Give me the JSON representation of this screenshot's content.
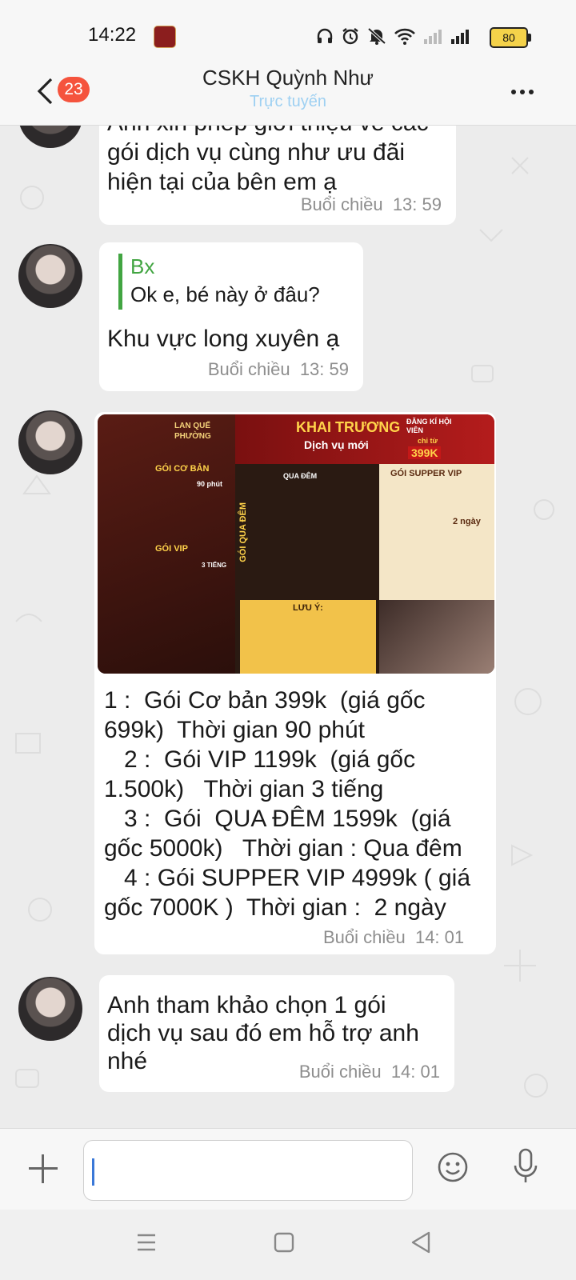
{
  "status_bar": {
    "time": "14:22",
    "battery": "80"
  },
  "header": {
    "title": "CSKH  Quỳnh Như",
    "presence": "Trực tuyến",
    "unread_badge": "23"
  },
  "messages": [
    {
      "lines": [
        "Anh xin phép giới thiệu vê các",
        "gói dịch vụ cùng như ưu đãi",
        "hiện tại của bên em ạ"
      ],
      "time": "Buổi chiều  13: 59"
    },
    {
      "quote": {
        "author": "Bx",
        "text": "Ok e, bé này ở đâu?"
      },
      "lines": [
        "Khu vực long xuyên ạ"
      ],
      "time": "Buổi chiều  13: 59"
    },
    {
      "lines": [
        "1 :  Gói Cơ bản 399k  (giá gốc",
        "699k)  Thời gian 90 phút",
        "   2 :  Gói VIP 1199k  (giá gốc",
        "1.500k)   Thời gian 3 tiếng",
        "   3 :  Gói  QUA ĐÊM 1599k  (giá",
        "gốc 5000k)   Thời gian : Qua đêm",
        "   4 : Gói SUPPER VIP 4999k ( giá",
        "gốc 7000K )  Thời gian :  2 ngày"
      ],
      "time": "Buổi chiều  14: 01"
    },
    {
      "lines": [
        "Anh tham khảo chọn 1 gói",
        "dịch vụ sau đó em hỗ trợ anh",
        "nhé"
      ],
      "time": "Buổi chiều  14: 01"
    }
  ],
  "promo_image": {
    "brand": "LAN QUẾ PHƯỜNG",
    "headline": "KHAI TRƯƠNG",
    "subheadline": "Dịch vụ mới",
    "member_label": "ĐĂNG KÍ HỘI VIÊN",
    "member_price_prefix": "chỉ từ",
    "member_price": "399K",
    "basic_title": "GÓI CƠ BẢN",
    "basic_duration": "90 phút",
    "vip_title": "GÓI VIP",
    "vip_duration": "3 TIẾNG",
    "overnight_title": "GÓI QUA ĐÊM",
    "overnight_tag": "QUA ĐÊM",
    "supper_title": "GÓI SUPPER VIP",
    "supper_duration": "2 ngày",
    "note_title": "LƯU Ý:"
  },
  "input": {
    "placeholder": ""
  },
  "colors": {
    "accent_green": "#42a542",
    "badge_red": "#f5533d",
    "presence_blue": "#9ed0f2"
  }
}
